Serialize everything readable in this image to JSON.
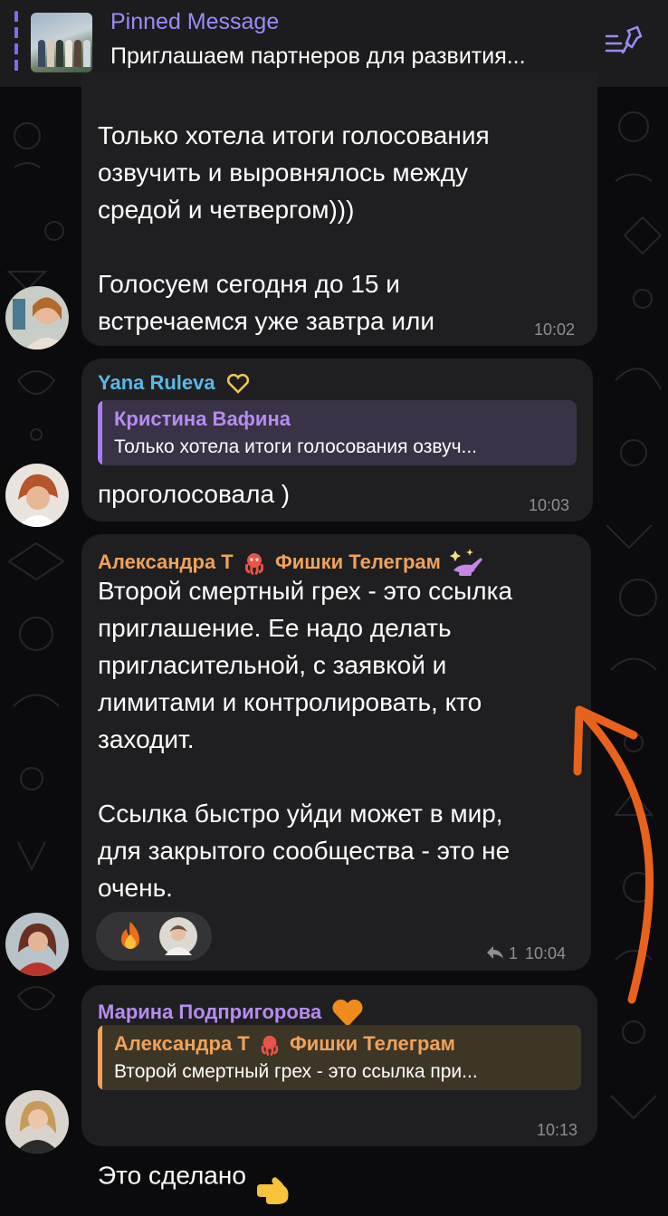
{
  "pinned": {
    "title": "Pinned Message",
    "text": "Приглашаем партнеров для развития..."
  },
  "messages": [
    {
      "text": "Только хотела итоги голосования\nозвучить и выровнялось между\nсредой и четвергом)))\n\nГолосуем сегодня до 15 и\nвстречаемся уже завтра или\nпослезавтра",
      "time": "10:02"
    },
    {
      "sender": "Yana Ruleva",
      "reply_name": "Кристина Вафина",
      "reply_text": "Только хотела итоги голосования озвуч...",
      "text": "проголосовала )",
      "time": "10:03"
    },
    {
      "sender": "Александра Т",
      "sender_suffix": "Фишки Телеграм",
      "text": "Второй смертный грех - это ссылка\nприглашение. Ее надо делать\nпригласительной, с заявкой и\nлимитами и контролировать, кто\nзаходит.\n\nСсылка быстро уйди может в мир,\nдля закрытого сообщества - это не\nочень.",
      "reply_count": "1",
      "time": "10:04"
    },
    {
      "sender": "Марина Подпригорова",
      "reply_name": "Александра Т",
      "reply_name_suffix": "Фишки Телеграм",
      "reply_text": "Второй смертный грех - это ссылка при...",
      "text": "Это сделано",
      "time": "10:13"
    }
  ],
  "colors": {
    "background": "#0b0b0d",
    "bubble": "#1f1f21",
    "pinned_accent": "#9a8df7",
    "yana_name": "#5ab8e6",
    "purple_name": "#b68cf2",
    "orange_name": "#f0a25a",
    "arrow": "#e8621c"
  },
  "icons": [
    "pinned-list-icon",
    "heart-outline-icon",
    "octopus-icon",
    "lamp-icon",
    "fire-icon",
    "reply-arrow-icon",
    "orange-heart-icon",
    "wink-emoji-icon",
    "pointing-hand-icon"
  ]
}
